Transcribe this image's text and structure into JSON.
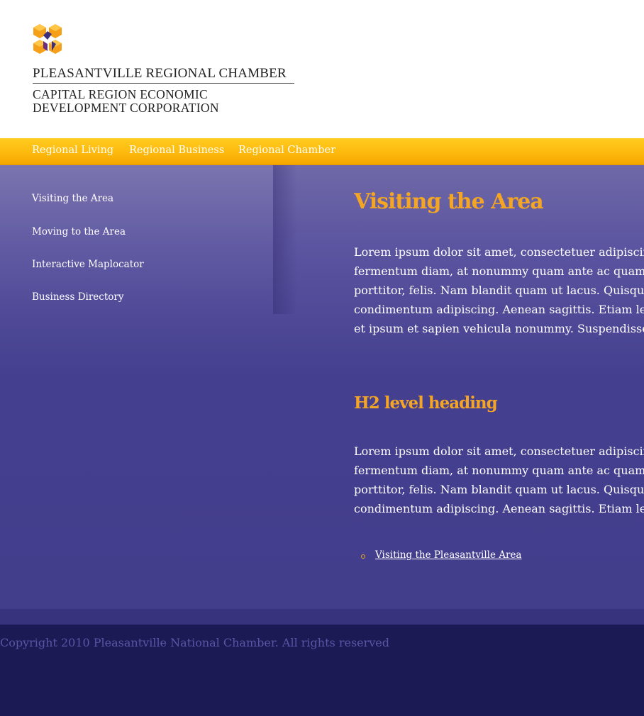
{
  "header": {
    "org_name": "PLEASANTVILLE REGIONAL CHAMBER",
    "org_sub_line1": "CAPITAL REGION ECONOMIC",
    "org_sub_line2": "DEVELOPMENT CORPORATION",
    "logo_icon": "hexagon-cube-logo-icon"
  },
  "topnav": {
    "items": [
      {
        "label": "Regional Living"
      },
      {
        "label": "Regional Business"
      },
      {
        "label": "Regional Chamber"
      }
    ]
  },
  "sidebar": {
    "items": [
      {
        "label": "Visiting the Area"
      },
      {
        "label": "Moving to the Area"
      },
      {
        "label": "Interactive Maplocator"
      },
      {
        "label": "Business Directory"
      }
    ]
  },
  "main": {
    "title": "Visiting the Area",
    "paragraph1": [
      "Lorem ipsum dolor sit amet, consectetuer adipiscing",
      "fermentum diam, at nonummy quam ante ac quam.",
      "porttitor, felis. Nam blandit quam ut lacus. Quisque",
      "condimentum adipiscing. Aenean sagittis. Etiam leo",
      "et ipsum et sapien vehicula nonummy. Suspendisse"
    ],
    "h2": "H2 level heading",
    "paragraph2": [
      "Lorem ipsum dolor sit amet, consectetuer adipiscing",
      "fermentum diam, at nonummy quam ante ac quam.",
      "porttitor, felis. Nam blandit quam ut lacus. Quisque",
      "condimentum adipiscing. Aenean sagittis. Etiam leo"
    ],
    "links": [
      {
        "label": "Visiting the Pleasantville Area"
      }
    ]
  },
  "footer": {
    "copyright": "Copyright 2010 Pleasantville National Chamber. All rights reserved"
  },
  "colors": {
    "accent_orange": "#f5a524",
    "nav_yellow": "#fdb90e",
    "main_purple": "#443f8f",
    "footer_navy": "#1c1a54",
    "logo_orange": "#f6a01a",
    "logo_purple": "#3d2f7e"
  }
}
